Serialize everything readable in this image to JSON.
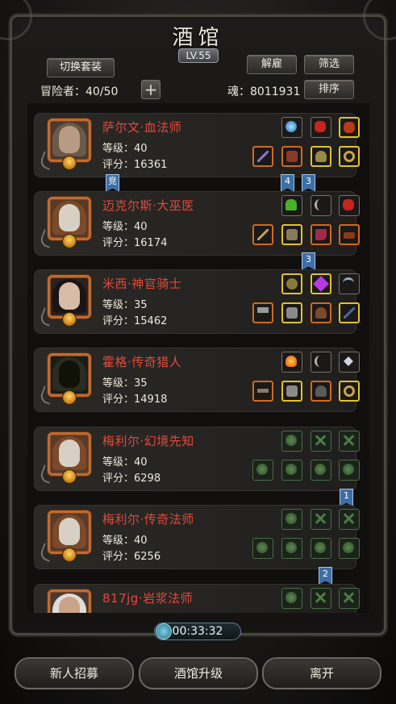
{
  "header": {
    "title": "酒馆",
    "level": "LV.55",
    "switch_outfit_label": "切换套装",
    "dismiss_label": "解雇",
    "filter_label": "筛选",
    "sort_label": "排序",
    "adventurers_label": "冒险者：40/50",
    "soul_label": "魂：8011931"
  },
  "heroes": [
    {
      "name": "萨尔文·血法师",
      "level": "等级：40",
      "score": "评分：16361",
      "badge": "竞",
      "portrait": "elf-mage"
    },
    {
      "name": "迈克尔斯·大巫医",
      "level": "等级：40",
      "score": "评分：16174",
      "portrait": "old-shaman"
    },
    {
      "name": "米西·神官骑士",
      "level": "等级：35",
      "score": "评分：15462",
      "portrait": "priestess"
    },
    {
      "name": "霍格·传奇猎人",
      "level": "等级：35",
      "score": "评分：14918",
      "portrait": "hooded-hunter"
    },
    {
      "name": "梅利尔·幻境先知",
      "level": "等级：40",
      "score": "评分：6298",
      "portrait": "old-sage"
    },
    {
      "name": "梅利尔·传奇法师",
      "level": "等级：40",
      "score": "评分：6256",
      "portrait": "old-sage"
    },
    {
      "name": "817jg·岩浆法师",
      "level": "",
      "score": "",
      "portrait": "white-hair"
    }
  ],
  "ribbons": [
    {
      "label": "4"
    },
    {
      "label": "3"
    },
    {
      "label": "3"
    },
    {
      "label": "1"
    },
    {
      "label": "2"
    }
  ],
  "colors": {
    "name_red": "#e24a3a",
    "orange_frame": "#d0691f",
    "gold_frame": "#e2c22b",
    "ribbon_blue": "#3d6fa6"
  },
  "footer": {
    "timer": "00:33:32",
    "recruit_label": "新人招募",
    "upgrade_label": "酒馆升级",
    "leave_label": "离开"
  }
}
